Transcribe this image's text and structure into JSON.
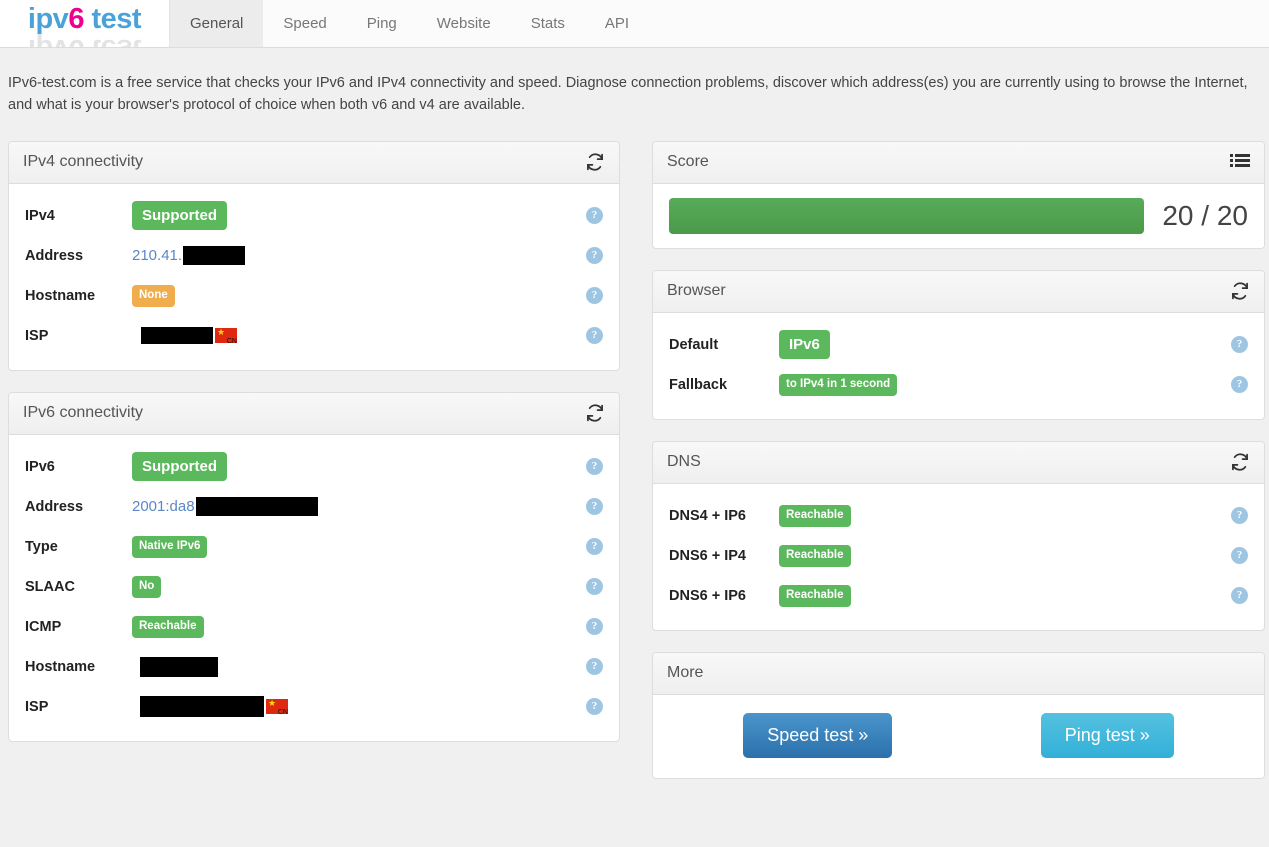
{
  "header": {
    "logo": {
      "part1": "ipv",
      "accent": "6",
      "part2": " test"
    },
    "nav": [
      {
        "label": "General",
        "active": true
      },
      {
        "label": "Speed",
        "active": false
      },
      {
        "label": "Ping",
        "active": false
      },
      {
        "label": "Website",
        "active": false
      },
      {
        "label": "Stats",
        "active": false
      },
      {
        "label": "API",
        "active": false
      }
    ]
  },
  "intro": {
    "text": "IPv6-test.com is a free service that checks your IPv6 and IPv4 connectivity and speed. Diagnose connection problems, discover which address(es) you are currently using to browse the Internet, and what is your browser's protocol of choice when both v6 and v4 are available."
  },
  "ipv4_panel": {
    "title": "IPv4 connectivity",
    "refresh_icon": "refresh-icon",
    "rows": [
      {
        "label": "IPv4",
        "type": "badge",
        "value": "Supported",
        "color": "green",
        "size": "lg",
        "help": "?"
      },
      {
        "label": "Address",
        "type": "address",
        "value": "210.41.",
        "redacted": true,
        "help": "?"
      },
      {
        "label": "Hostname",
        "type": "badge",
        "value": "None",
        "color": "orange",
        "size": "sm",
        "help": "?"
      },
      {
        "label": "ISP",
        "type": "redacted-flag",
        "value": "",
        "flag": "CN",
        "help": "?"
      }
    ]
  },
  "ipv6_panel": {
    "title": "IPv6 connectivity",
    "refresh_icon": "refresh-icon",
    "rows": [
      {
        "label": "IPv6",
        "type": "badge",
        "value": "Supported",
        "color": "green",
        "size": "lg",
        "help": "?"
      },
      {
        "label": "Address",
        "type": "address",
        "value": "2001:da8",
        "redacted": true,
        "help": "?"
      },
      {
        "label": "Type",
        "type": "badge",
        "value": "Native IPv6",
        "color": "green",
        "size": "sm",
        "help": "?"
      },
      {
        "label": "SLAAC",
        "type": "badge",
        "value": "No",
        "color": "green",
        "size": "sm",
        "help": "?"
      },
      {
        "label": "ICMP",
        "type": "badge",
        "value": "Reachable",
        "color": "green",
        "size": "sm",
        "help": "?"
      },
      {
        "label": "Hostname",
        "type": "redacted",
        "value": "",
        "help": "?"
      },
      {
        "label": "ISP",
        "type": "redacted-flag",
        "value": "",
        "flag": "CN",
        "help": "?"
      }
    ]
  },
  "score_panel": {
    "title": "Score",
    "list_icon": "list-icon",
    "value": "20 / 20",
    "percent": 100,
    "bar_color": "#4f9f4f"
  },
  "browser_panel": {
    "title": "Browser",
    "refresh_icon": "refresh-icon",
    "rows": [
      {
        "label": "Default",
        "value": "IPv6",
        "color": "green",
        "size": "lg",
        "help": "?"
      },
      {
        "label": "Fallback",
        "value": "to IPv4 in 1 second",
        "color": "green",
        "size": "sm",
        "help": "?"
      }
    ]
  },
  "dns_panel": {
    "title": "DNS",
    "refresh_icon": "refresh-icon",
    "rows": [
      {
        "label": "DNS4 + IP6",
        "value": "Reachable",
        "color": "green",
        "size": "sm",
        "help": "?"
      },
      {
        "label": "DNS6 + IP4",
        "value": "Reachable",
        "color": "green",
        "size": "sm",
        "help": "?"
      },
      {
        "label": "DNS6 + IP6",
        "value": "Reachable",
        "color": "green",
        "size": "sm",
        "help": "?"
      }
    ]
  },
  "more_panel": {
    "title": "More",
    "speed_button": "Speed test »",
    "ping_button": "Ping test »"
  },
  "colors": {
    "green": "#5cb85c",
    "orange": "#f0ad4e",
    "link": "#5b87c7",
    "logo_blue": "#4aa3d8",
    "logo_pink": "#ec008c"
  }
}
